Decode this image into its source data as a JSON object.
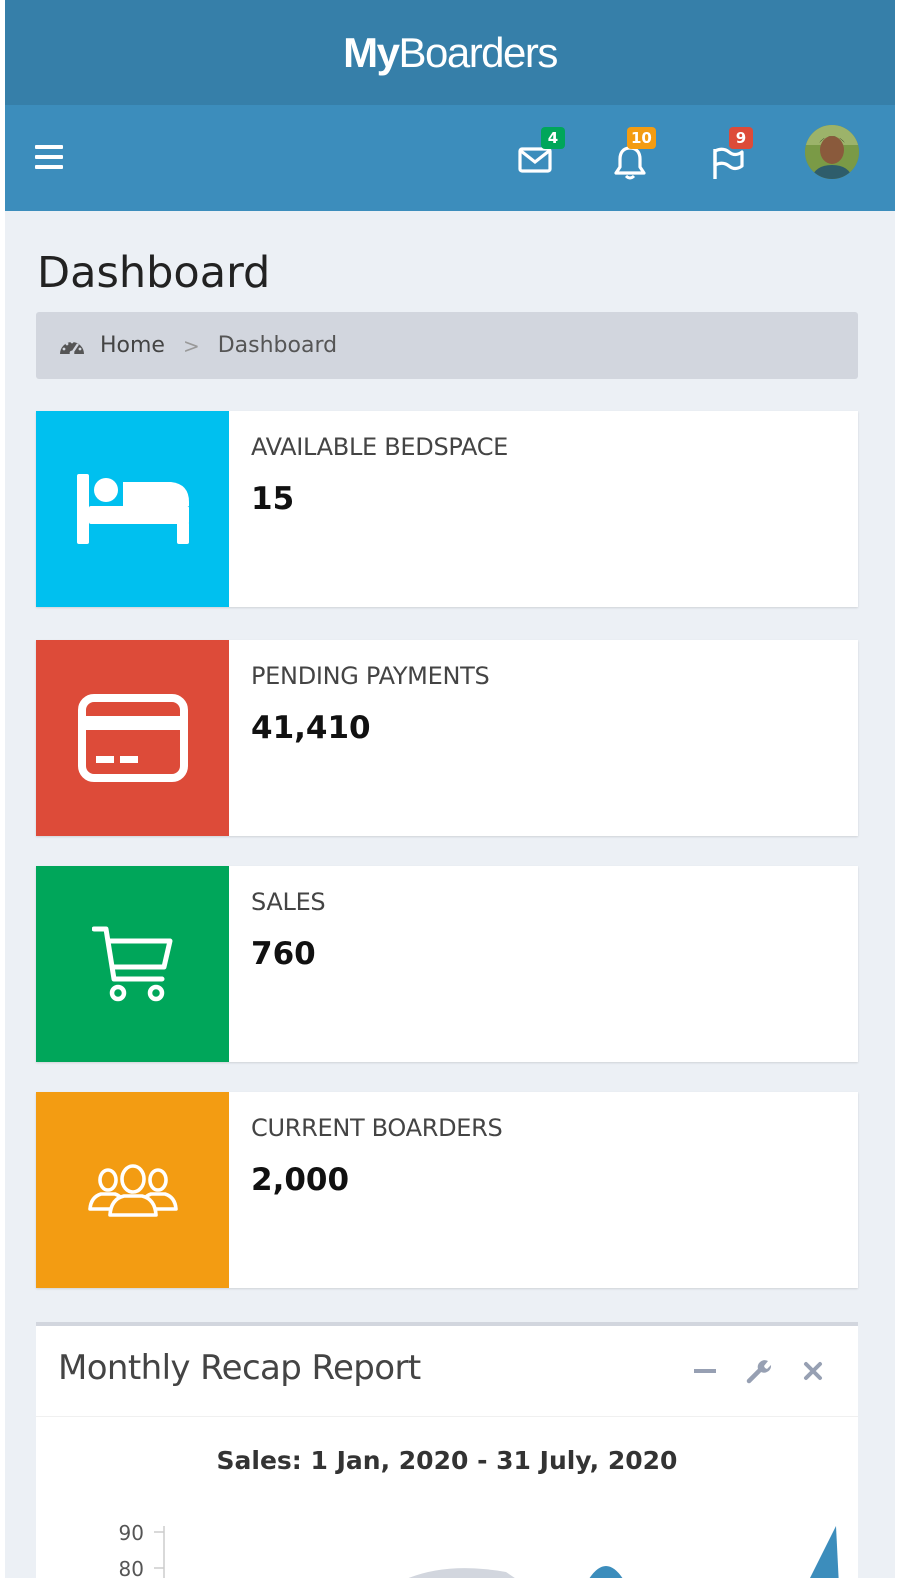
{
  "app": {
    "logo_bold": "My",
    "logo_rest": "Boarders"
  },
  "navbar": {
    "messages_count": "4",
    "notifications_count": "10",
    "tasks_count": "9",
    "colors": {
      "messages": "#00a65a",
      "notifications": "#f39c12",
      "tasks": "#dd4b39"
    }
  },
  "page": {
    "title": "Dashboard",
    "breadcrumb": {
      "home": "Home",
      "separator": ">",
      "current": "Dashboard"
    }
  },
  "info_boxes": [
    {
      "label": "AVAILABLE BEDSPACE",
      "value": "15",
      "color": "#00c0ef",
      "icon": "bed-icon"
    },
    {
      "label": "PENDING PAYMENTS",
      "value": "41,410",
      "color": "#dd4b39",
      "icon": "credit-card-icon"
    },
    {
      "label": "SALES",
      "value": "760",
      "color": "#00a65a",
      "icon": "shopping-cart-icon"
    },
    {
      "label": "CURRENT BOARDERS",
      "value": "2,000",
      "color": "#f39c12",
      "icon": "users-icon"
    }
  ],
  "report": {
    "title": "Monthly Recap Report",
    "chart_heading": "Sales: 1 Jan, 2020 - 31 July, 2020"
  },
  "chart_data": {
    "type": "area",
    "title": "Sales: 1 Jan, 2020 - 31 July, 2020",
    "y_ticks": [
      90,
      80
    ],
    "ylim": [
      0,
      90
    ]
  }
}
